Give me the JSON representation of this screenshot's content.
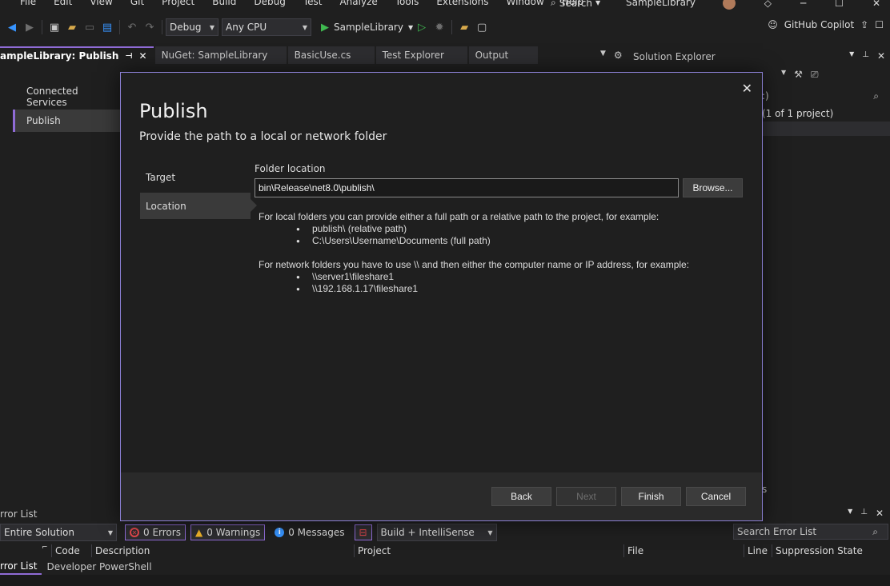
{
  "menubar": {
    "items": [
      "File",
      "Edit",
      "View",
      "Git",
      "Project",
      "Build",
      "Debug",
      "Test",
      "Analyze",
      "Tools",
      "Extensions",
      "Window",
      "Help"
    ],
    "search_label": "Search",
    "title": "SampleLibrary"
  },
  "toolbar": {
    "configuration": "Debug",
    "platform": "Any CPU",
    "run_target": "SampleLibrary",
    "copilot_label": "GitHub Copilot"
  },
  "tabs": [
    {
      "label": "ampleLibrary: Publish",
      "active": true
    },
    {
      "label": "NuGet: SampleLibrary",
      "active": false
    },
    {
      "label": "BasicUse.cs",
      "active": false
    },
    {
      "label": "Test Explorer",
      "active": false
    },
    {
      "label": "Output",
      "active": false
    }
  ],
  "left_nav": {
    "items": [
      "Connected Services",
      "Publish"
    ]
  },
  "solution_explorer": {
    "title": "Solution Explorer",
    "search_placeholder": ":)",
    "solution_label": "(1 of 1 project)",
    "tail_text": "s"
  },
  "dialog": {
    "title": "Publish",
    "subtitle": "Provide the path to a local or network folder",
    "steps": [
      "Target",
      "Location"
    ],
    "folder_label": "Folder location",
    "folder_value": "bin\\Release\\net8.0\\publish\\",
    "browse_label": "Browse...",
    "local_help": "For local folders you can provide either a full path or a relative path to the project, for example:",
    "local_examples": [
      "publish\\ (relative path)",
      "C:\\Users\\Username\\Documents (full path)"
    ],
    "network_help": "For network folders you have to use \\\\ and then either the computer name or IP address, for example:",
    "network_examples": [
      "\\\\server1\\fileshare1",
      "\\\\192.168.1.17\\fileshare1"
    ],
    "back_label": "Back",
    "next_label": "Next",
    "finish_label": "Finish",
    "cancel_label": "Cancel"
  },
  "error_list": {
    "title": "rror List",
    "scope": "Entire Solution",
    "errors": "0 Errors",
    "warnings": "0 Warnings",
    "messages": "0 Messages",
    "build_filter": "Build + IntelliSense",
    "search_placeholder": "Search Error List",
    "columns": [
      "Code",
      "Description",
      "Project",
      "File",
      "Line",
      "Suppression State"
    ],
    "bottom_tabs": [
      "rror List",
      "Developer PowerShell"
    ]
  },
  "colors": {
    "accent": "#8f6bd6",
    "error": "#e5484d",
    "warning": "#f0b429",
    "info": "#3794ff",
    "run": "#3fb950"
  }
}
